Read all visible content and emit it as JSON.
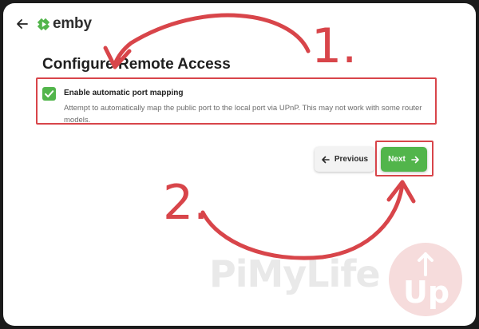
{
  "header": {
    "back_icon": "arrow-left-icon",
    "logo_text": "emby",
    "logo_color": "#52b54b"
  },
  "page": {
    "title": "Configure Remote Access",
    "option": {
      "checked": true,
      "label": "Enable automatic port mapping",
      "description": "Attempt to automatically map the public port to the local port via UPnP. This may not work with some router models."
    },
    "buttons": {
      "previous_label": "Previous",
      "next_label": "Next"
    }
  },
  "annotations": {
    "step1": "1.",
    "step2": "2.",
    "color": "#d8454a"
  },
  "watermark": {
    "text": "PiMyLife",
    "badge_text": "Up"
  }
}
